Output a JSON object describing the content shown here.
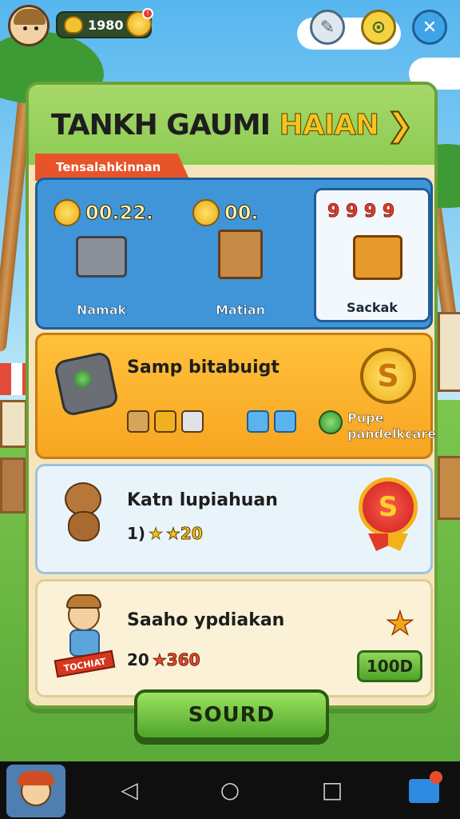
{
  "top_bar": {
    "coins_value": "1980",
    "notification_badge": "!",
    "icons": [
      "chat-icon",
      "map-pin-icon",
      "close-icon"
    ]
  },
  "panel": {
    "title_main": "TANKH GAUMI",
    "title_highlight": "HAIAN",
    "arrow": "❯",
    "ribbon_label": "Tensalahkinnan"
  },
  "categories": [
    {
      "price": "00.22.",
      "label": "Namak"
    },
    {
      "price": "00.",
      "label": "Matian"
    },
    {
      "price": "",
      "label": "Sackak",
      "deco_numbers": "9 9 9 9",
      "selected": true
    }
  ],
  "cards": [
    {
      "name": "Samp bitabuigt",
      "coin_symbol": "S",
      "extra_title": "Pupe",
      "extra_sub": "pandelkcare"
    },
    {
      "name": "Katn lupiahuan",
      "sub_prefix": "1)",
      "star": "★",
      "sub_value": "★20",
      "medal_symbol": "S"
    },
    {
      "name": "Saaho ypdiakan",
      "sub_prefix": "20",
      "sub_value": "★360",
      "tag_text": "TOCHIAT",
      "star": "★",
      "price_button": "100D"
    }
  ],
  "main_button": "SOURD",
  "navbar": {
    "back": "◁",
    "home": "○",
    "recent": "□"
  },
  "colors": {
    "panel_border": "#6aa237",
    "accent_gold": "#f5c41e",
    "category_blue": "#3f95d8",
    "button_green": "#4fa52a"
  }
}
